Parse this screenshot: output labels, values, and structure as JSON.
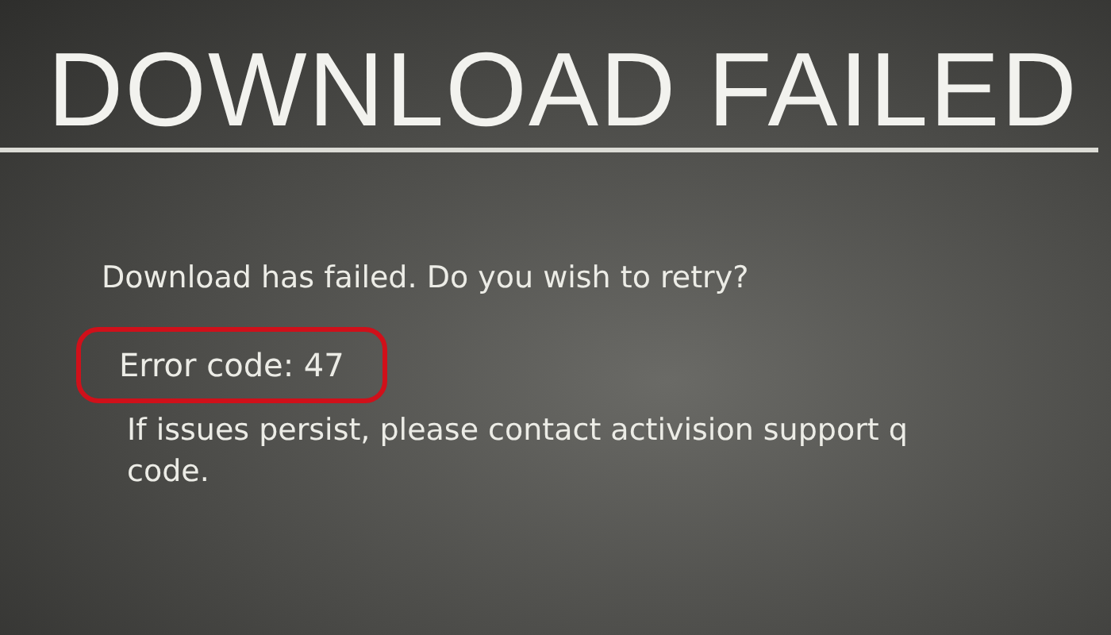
{
  "title": "DOWNLOAD FAILED",
  "message": "Download has failed. Do you wish to retry?",
  "error_code": {
    "text": "Error code: 47",
    "highlighted": true
  },
  "help_lines": [
    "If issues persist, please contact activision support q",
    "code."
  ]
}
